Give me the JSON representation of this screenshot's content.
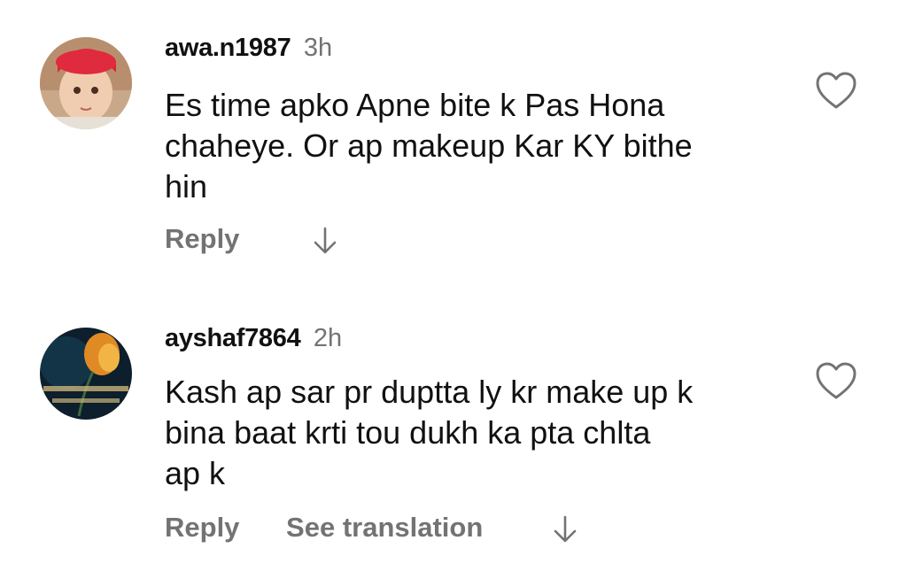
{
  "comments": [
    {
      "username": "awa.n1987",
      "time": "3h",
      "lines": [
        "Es time apko Apne bite k Pas Hona",
        "chaheye. Or ap makeup Kar KY bithe",
        "hin"
      ],
      "reply_label": "Reply",
      "avatar_icon": "child-photo-avatar",
      "like_icon": "heart-outline-icon",
      "more_icon": "arrow-down-icon"
    },
    {
      "username": "ayshaf7864",
      "time": "2h",
      "lines": [
        "Kash ap sar pr duptta ly kr make up k",
        "bina baat krti tou dukh ka pta chlta",
        "ap k"
      ],
      "reply_label": "Reply",
      "translate_label": "See translation",
      "avatar_icon": "dark-flower-avatar",
      "like_icon": "heart-outline-icon",
      "more_icon": "arrow-down-icon"
    }
  ],
  "colors": {
    "text": "#111111",
    "secondary": "#737373",
    "background": "#ffffff"
  }
}
